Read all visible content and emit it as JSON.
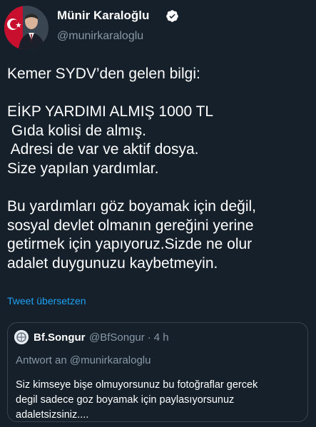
{
  "tweet": {
    "author": {
      "display_name": "Münir Karaloğlu",
      "handle": "@munirkaraloglu",
      "verified": true,
      "avatar_icon": "profile-photo-with-flag"
    },
    "text_lines": [
      "Kemer SYDV’den gelen bilgi:",
      "",
      "EİKP YARDIMI ALMIŞ 1000 TL",
      " Gıda kolisi de almış.",
      " Adresi de var ve aktif dosya.",
      "Size yapılan yardımlar.",
      "",
      "Bu yardımları göz boyamak için değil,",
      "sosyal devlet olmanın gereğini yerine",
      "getirmek için yapıyoruz.Sizde ne olur",
      "adalet duygunuzu kaybetmeyin."
    ],
    "translate_label": "Tweet übersetzen"
  },
  "quoted_tweet": {
    "display_name": "Bf.Songur",
    "handle": "@BfSongur",
    "separator": "·",
    "time": "4 h",
    "reply_to": "Antwort an @munirkaraloglu",
    "text_lines": [
      "Siz kimseye bişe olmuyorsunuz bu fotoğraflar gercek",
      "degil sadece goz boyamak için paylasıyorsunuz",
      "adaletsizsiniz...."
    ]
  },
  "colors": {
    "background": "#15202b",
    "primary_text": "#ffffff",
    "secondary_text": "#8899a6",
    "link": "#1da1f2",
    "border": "#38444d",
    "verified_badge": "#ffffff"
  }
}
